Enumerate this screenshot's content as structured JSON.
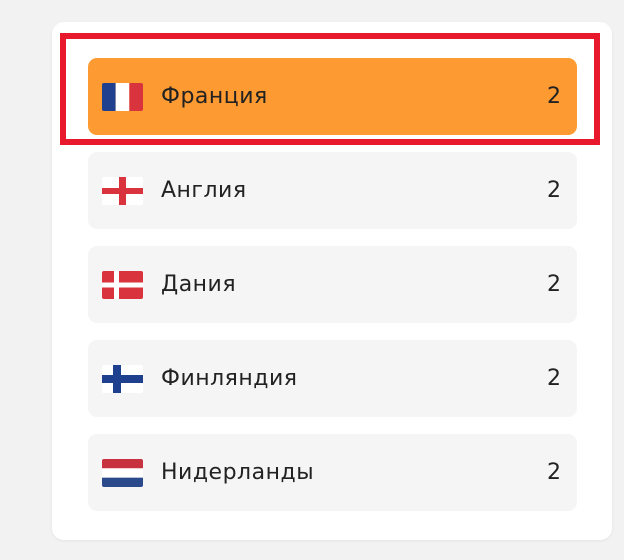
{
  "countries": {
    "items": [
      {
        "label": "Франция",
        "count": "2",
        "flag": "france-flag",
        "active": true
      },
      {
        "label": "Англия",
        "count": "2",
        "flag": "england-flag",
        "active": false
      },
      {
        "label": "Дания",
        "count": "2",
        "flag": "denmark-flag",
        "active": false
      },
      {
        "label": "Финляндия",
        "count": "2",
        "flag": "finland-flag",
        "active": false
      },
      {
        "label": "Нидерланды",
        "count": "2",
        "flag": "netherlands-flag",
        "active": false
      }
    ]
  },
  "colors": {
    "active_bg": "#fd9a31",
    "item_bg": "#f5f5f5",
    "highlight": "#e8192c"
  }
}
